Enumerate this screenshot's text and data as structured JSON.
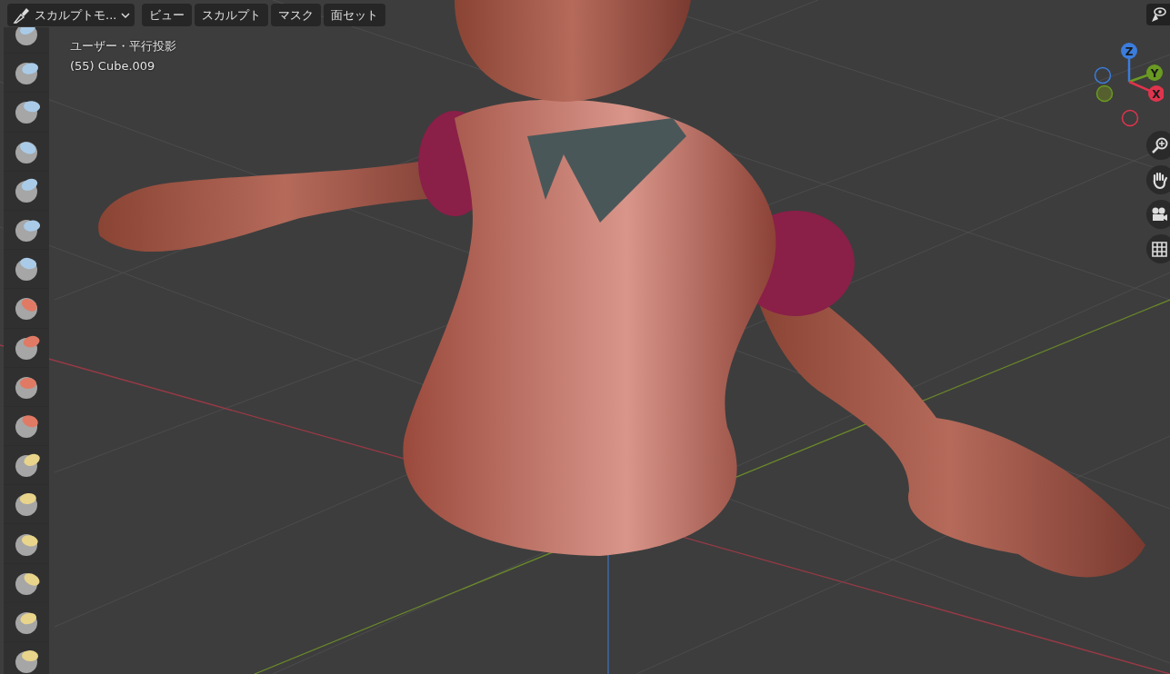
{
  "header": {
    "mode": {
      "label": "スカルプトモ..."
    },
    "menus": [
      "ビュー",
      "スカルプト",
      "マスク",
      "面セット"
    ]
  },
  "overlay_info": [
    "ユーザー・平行投影",
    "(55) Cube.009"
  ],
  "toolbar": {
    "tools": [
      {
        "color": "#a9cbe8"
      },
      {
        "color": "#a9cbe8"
      },
      {
        "color": "#a9cbe8"
      },
      {
        "color": "#a9cbe8"
      },
      {
        "color": "#a9cbe8"
      },
      {
        "color": "#a9cbe8"
      },
      {
        "color": "#a9cbe8"
      },
      {
        "color": "#e07a64"
      },
      {
        "color": "#e07a64"
      },
      {
        "color": "#e07a64"
      },
      {
        "color": "#e07a64"
      },
      {
        "color": "#e8d48a"
      },
      {
        "color": "#e8d48a"
      },
      {
        "color": "#e8d48a"
      },
      {
        "color": "#e8d48a"
      },
      {
        "color": "#e8d48a"
      },
      {
        "color": "#e8d48a"
      }
    ]
  },
  "gizmo": {
    "axes": [
      {
        "label": "Z",
        "color": "#3b7ddd"
      },
      {
        "label": "Y",
        "color": "#6a9a22"
      },
      {
        "label": "X",
        "color": "#e0344d"
      }
    ]
  }
}
